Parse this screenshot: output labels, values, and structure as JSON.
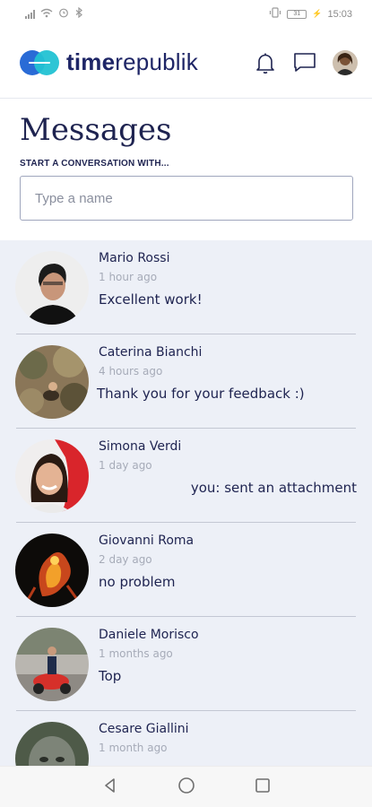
{
  "status_bar": {
    "time": "15:03",
    "battery": "31",
    "icons": [
      "signal-icon",
      "wifi-icon",
      "alarm-icon",
      "bluetooth-icon",
      "vibrate-icon",
      "battery-icon"
    ]
  },
  "app": {
    "logo_text_bold": "time",
    "logo_text_light": "republik",
    "header_icons": [
      "bell-icon",
      "chat-icon",
      "profile-avatar"
    ]
  },
  "page": {
    "title": "Messages",
    "start_label": "START A CONVERSATION WITH...",
    "search_placeholder": "Type a name"
  },
  "conversations": [
    {
      "name": "Mario Rossi",
      "time": "1 hour ago",
      "message": "Excellent work!"
    },
    {
      "name": "Caterina Bianchi",
      "time": "4 hours ago",
      "message": "Thank you for your feedback :)"
    },
    {
      "name": "Simona Verdi",
      "time": "1 day ago",
      "message": "you: sent an attachment"
    },
    {
      "name": "Giovanni Roma",
      "time": "2 day ago",
      "message": "no problem"
    },
    {
      "name": "Daniele Morisco",
      "time": "1 months ago",
      "message": "Top"
    },
    {
      "name": "Cesare Giallini",
      "time": "1 month ago",
      "message": ""
    }
  ],
  "nav": [
    "back-icon",
    "home-icon",
    "recents-icon"
  ],
  "colors": {
    "brand_navy": "#1e2350",
    "logo_blue": "#2a6bd6",
    "logo_cyan": "#22c2d3",
    "list_bg": "#edf0f7"
  }
}
